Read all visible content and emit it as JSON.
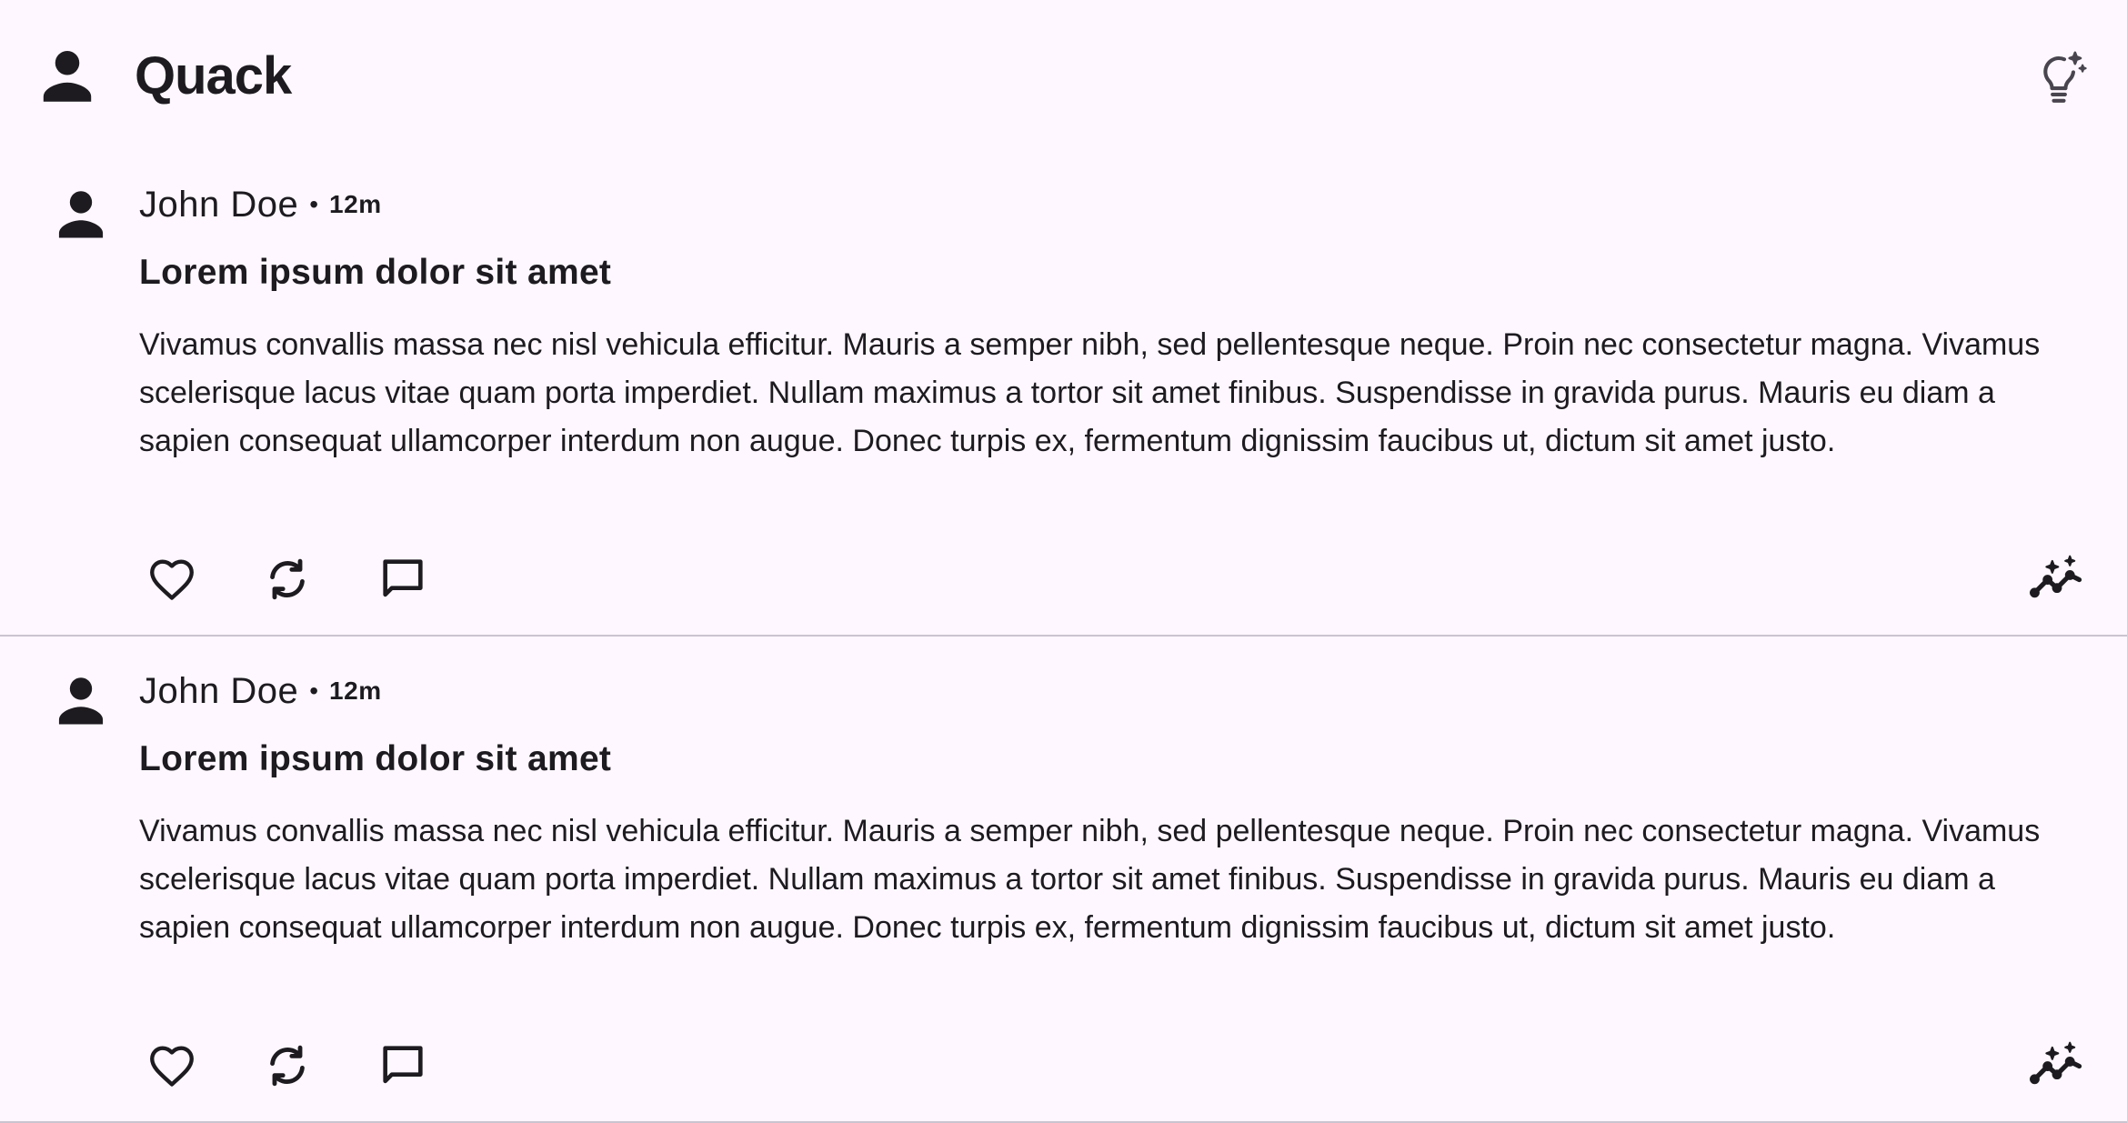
{
  "app_bar": {
    "title": "Quack",
    "left_icon": "person-icon",
    "right_icon": "lightbulb-sparkle-icon"
  },
  "posts": [
    {
      "author": "John Doe",
      "separator": "•",
      "time": "12m",
      "title": "Lorem ipsum dolor sit amet",
      "body": "Vivamus convallis massa nec nisl vehicula efficitur. Mauris a semper nibh, sed pellentesque neque. Proin nec consectetur magna. Vivamus scelerisque lacus vitae quam porta imperdiet. Nullam maximus a tortor sit amet finibus. Suspendisse in gravida purus. Mauris eu diam a sapien consequat ullamcorper interdum non augue. Donec turpis ex, fermentum dignissim faucibus ut, dictum sit amet justo.",
      "actions": [
        "heart-icon",
        "repost-icon",
        "comment-icon"
      ],
      "extra_action": "insights-sparkle-icon"
    },
    {
      "author": "John Doe",
      "separator": "•",
      "time": "12m",
      "title": "Lorem ipsum dolor sit amet",
      "body": "Vivamus convallis massa nec nisl vehicula efficitur. Mauris a semper nibh, sed pellentesque neque. Proin nec consectetur magna. Vivamus scelerisque lacus vitae quam porta imperdiet. Nullam maximus a tortor sit amet finibus. Suspendisse in gravida purus. Mauris eu diam a sapien consequat ullamcorper interdum non augue. Donec turpis ex, fermentum dignissim faucibus ut, dictum sit amet justo.",
      "actions": [
        "heart-icon",
        "repost-icon",
        "comment-icon"
      ],
      "extra_action": "insights-sparkle-icon"
    }
  ],
  "colors": {
    "background": "#FEF7FF",
    "text": "#1D1B20",
    "divider": "#CAC4D0"
  }
}
